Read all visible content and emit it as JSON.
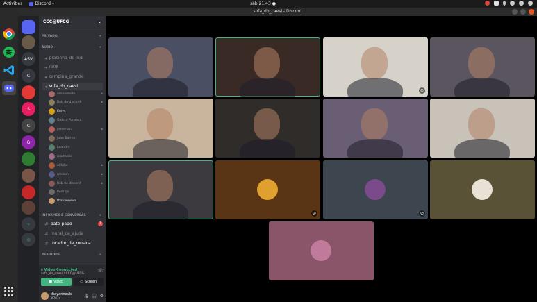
{
  "topbar": {
    "activities": "Activities",
    "app": "Discord",
    "clock": "sáb 21:43 ●"
  },
  "window": {
    "title": "sofa_do_caesi - Discord"
  },
  "dock": {
    "items": [
      {
        "name": "chrome-icon",
        "color": "#4285f4",
        "glyph": "●"
      },
      {
        "name": "spotify-icon",
        "color": "#1db954",
        "glyph": "≋"
      },
      {
        "name": "vscode-icon",
        "color": "#0078d4",
        "glyph": "❮❯"
      },
      {
        "name": "discord-icon",
        "color": "#5865f2",
        "glyph": "◉"
      }
    ]
  },
  "guilds": {
    "items": [
      {
        "label": "",
        "color": "#5865f2",
        "kind": "home"
      },
      {
        "label": "",
        "color": "#6a5a4a",
        "kind": "avatar"
      },
      {
        "label": "ASV",
        "color": "#36393f",
        "kind": "text"
      },
      {
        "label": "C",
        "color": "#36393f",
        "kind": "text"
      },
      {
        "label": "",
        "color": "#e53935",
        "kind": "icon"
      },
      {
        "label": "S",
        "color": "#e91e63",
        "kind": "text"
      },
      {
        "label": "C",
        "color": "#444",
        "kind": "text"
      },
      {
        "label": "G",
        "color": "#8e24aa",
        "kind": "text"
      },
      {
        "label": "",
        "color": "#2e7d32",
        "kind": "avatar"
      },
      {
        "label": "",
        "color": "#795548",
        "kind": "avatar"
      },
      {
        "label": "",
        "color": "#c62828",
        "kind": "icon"
      },
      {
        "label": "",
        "color": "#5d4037",
        "kind": "avatar"
      },
      {
        "label": "+",
        "color": "#36393f",
        "kind": "add"
      },
      {
        "label": "◎",
        "color": "#36393f",
        "kind": "explore"
      }
    ]
  },
  "server": {
    "name": "CCC@UFCG"
  },
  "categories": {
    "privado": "PRIVADO",
    "audio": "ÁUDIO",
    "informes": "INFORMES E CONVERSAS",
    "periodos": "PERÍODOS"
  },
  "voice_channels": [
    "pracinha_do_lsd",
    "re08",
    "campina_grande",
    "sofa_do_caesi"
  ],
  "voice_users": [
    {
      "name": "amaurinebu",
      "color": "#a86a6a",
      "icon": "🎙"
    },
    {
      "name": "Bob do discord",
      "color": "#8a7f5a",
      "icon": "🎙"
    },
    {
      "name": "Emys",
      "color": "#d4a017",
      "icon": "",
      "bright": true
    },
    {
      "name": "Gabrio Fonseca",
      "color": "#607d8b",
      "icon": ""
    },
    {
      "name": "joseenan",
      "color": "#b35d5d",
      "icon": "🎙"
    },
    {
      "name": "Juan Barros",
      "color": "#7e6b5a",
      "icon": ""
    },
    {
      "name": "Leandro",
      "color": "#5a7e6b",
      "icon": ""
    },
    {
      "name": "martalais",
      "color": "#9c6b8a",
      "icon": ""
    },
    {
      "name": "olduhe",
      "color": "#a85a3a",
      "icon": "🎙"
    },
    {
      "name": "renison",
      "color": "#5a5a8a",
      "icon": "🎙"
    },
    {
      "name": "Rob do discord",
      "color": "#8a5a5a",
      "icon": "🎙"
    },
    {
      "name": "Rodrigo",
      "color": "#6b6b6b",
      "icon": ""
    },
    {
      "name": "thayannevls",
      "color": "#c79a6f",
      "icon": "",
      "bright": true
    }
  ],
  "text_channels": [
    {
      "name": "bate-papo",
      "bright": true,
      "badge": "1"
    },
    {
      "name": "mural_de_ajuda",
      "bright": false,
      "badge": ""
    },
    {
      "name": "tocador_de_musica",
      "bright": true,
      "badge": ""
    }
  ],
  "voice_panel": {
    "status": "Video Connected",
    "channel": "sofa_do_caesi / CCC@UFCG",
    "video_label": "Video",
    "screen_label": "Screen"
  },
  "user_panel": {
    "name": "thayannevls",
    "tag": "#7034"
  },
  "tiles": [
    {
      "bg": "#4a4f63",
      "speaking": false,
      "mute": false
    },
    {
      "bg": "#3a2a26",
      "speaking": true,
      "mute": false
    },
    {
      "bg": "#d6d2ca",
      "speaking": false,
      "mute": true
    },
    {
      "bg": "#5b5560",
      "speaking": false,
      "mute": false
    },
    {
      "bg": "#c9b59e",
      "speaking": false,
      "mute": false
    },
    {
      "bg": "#2f2c2a",
      "speaking": false,
      "mute": false
    },
    {
      "bg": "#6a5e74",
      "speaking": false,
      "mute": false
    },
    {
      "bg": "#c8c2b8",
      "speaking": false,
      "mute": false
    },
    {
      "bg": "#3c3a3e",
      "speaking": true,
      "mute": false
    },
    {
      "bg": "#5a3515",
      "speaking": false,
      "mute": true,
      "avatar": "#e0a030"
    },
    {
      "bg": "#3d454f",
      "speaking": false,
      "mute": true,
      "avatar": "#7a4a8a"
    },
    {
      "bg": "#5a5236",
      "speaking": false,
      "mute": false,
      "avatar": "#e8e2d6"
    },
    {
      "bg": "#8a5568",
      "speaking": false,
      "mute": false,
      "avatar": "#c07a9a"
    }
  ]
}
